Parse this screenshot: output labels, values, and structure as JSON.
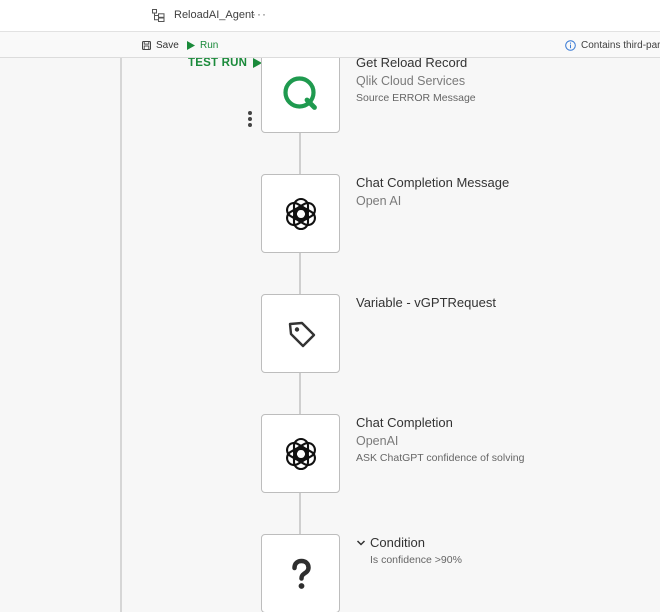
{
  "header": {
    "app_name": "ReloadAI_Agent",
    "more_label": "···"
  },
  "toolbar": {
    "save_label": "Save",
    "run_label": "Run",
    "info_text": "Contains third-party"
  },
  "canvas": {
    "test_run_label": "TEST RUN"
  },
  "blocks": [
    {
      "title": "Get Reload Record",
      "subtitle": "Qlik Cloud Services",
      "description": "Source ERROR Message",
      "icon": "qlik-logo-icon"
    },
    {
      "title": "Chat Completion Message",
      "subtitle": "Open AI",
      "icon": "openai-logo-icon"
    },
    {
      "title": "Variable - vGPTRequest",
      "icon": "tag-icon"
    },
    {
      "title": "Chat Completion",
      "subtitle": "OpenAI",
      "description": "ASK ChatGPT confidence of solving",
      "icon": "openai-logo-icon"
    },
    {
      "title": "Condition",
      "description": "Is confidence >90%",
      "icon": "question-mark-icon"
    }
  ],
  "colors": {
    "accent_green": "#1a8a3a",
    "qlik_green": "#1f9a4f",
    "block_border": "#bdbdbd",
    "canvas_bg": "#f7f7f7"
  }
}
